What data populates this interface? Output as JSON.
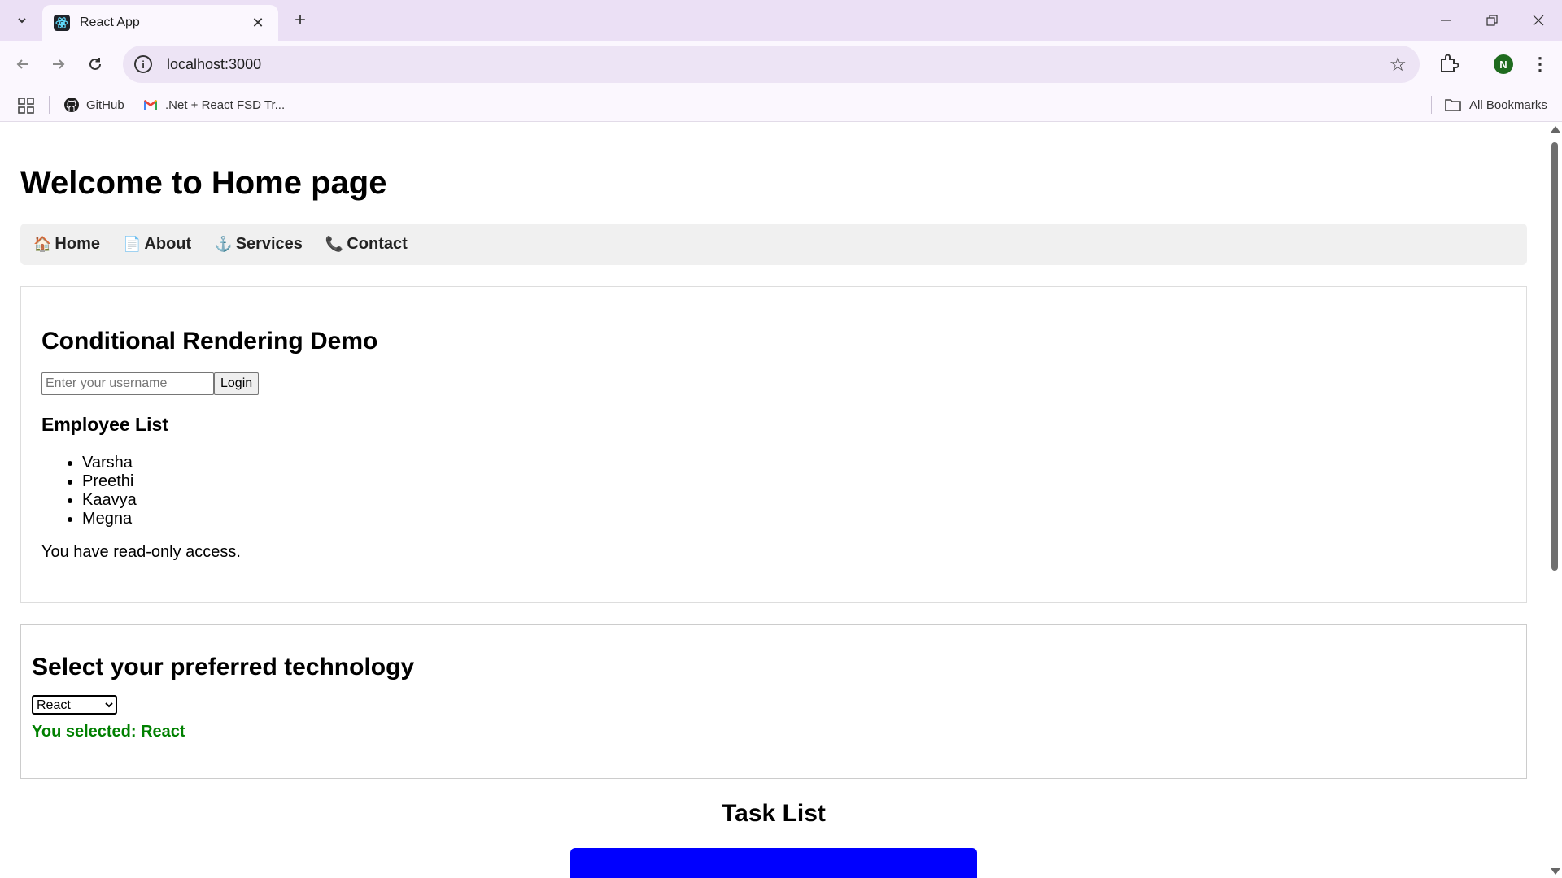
{
  "browser": {
    "tab_title": "React App",
    "url": "localhost:3000",
    "profile_initial": "N",
    "bookmarks": [
      {
        "label": "GitHub",
        "icon": "github-icon"
      },
      {
        "label": ".Net + React FSD Tr...",
        "icon": "gmail-icon"
      }
    ],
    "all_bookmarks_label": "All Bookmarks"
  },
  "page": {
    "title": "Welcome to Home page",
    "nav": [
      {
        "label": "Home",
        "icon": "🏠"
      },
      {
        "label": "About",
        "icon": "📄"
      },
      {
        "label": "Services",
        "icon": "⚓"
      },
      {
        "label": "Contact",
        "icon": "📞"
      }
    ],
    "conditional": {
      "heading": "Conditional Rendering Demo",
      "username_placeholder": "Enter your username",
      "login_label": "Login",
      "list_heading": "Employee List",
      "employees": [
        "Varsha",
        "Preethi",
        "Kaavya",
        "Megna"
      ],
      "access_note": "You have read-only access."
    },
    "technology": {
      "heading": "Select your preferred technology",
      "selected_option": "React",
      "selected_note": "You selected: React",
      "note_color": "#008000"
    },
    "tasks": {
      "heading": "Task List",
      "box_color": "#0000ff"
    }
  }
}
